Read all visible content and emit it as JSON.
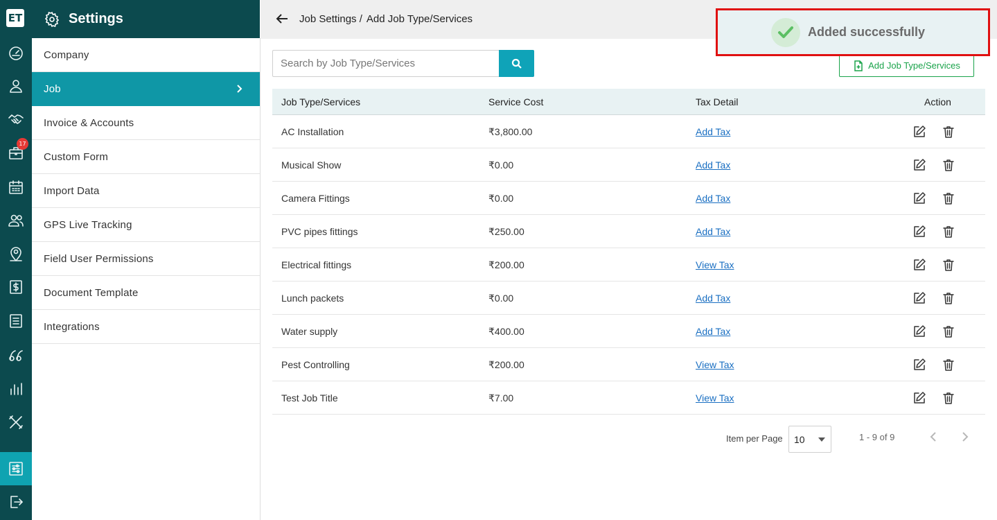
{
  "rail": {
    "logo_text": "ET",
    "badge_count": "17",
    "icons": [
      "dashboard-icon",
      "user-icon",
      "handshake-icon",
      "briefcase-icon",
      "calendar-icon",
      "users-icon",
      "location-user-icon",
      "dollar-icon",
      "list-icon",
      "leads-icon",
      "reports-icon",
      "tools-icon",
      "settings-sliders-icon",
      "logout-icon"
    ]
  },
  "settings": {
    "title": "Settings",
    "menu": [
      {
        "label": "Company"
      },
      {
        "label": "Job"
      },
      {
        "label": "Invoice & Accounts"
      },
      {
        "label": "Custom Form"
      },
      {
        "label": "Import Data"
      },
      {
        "label": "GPS Live Tracking"
      },
      {
        "label": "Field User Permissions"
      },
      {
        "label": "Document Template"
      },
      {
        "label": "Integrations"
      }
    ],
    "active_item": "Job"
  },
  "breadcrumb": {
    "parent": "Job Settings /",
    "current": "Add Job Type/Services"
  },
  "search": {
    "placeholder": "Search by Job Type/Services",
    "value": ""
  },
  "add_button": {
    "label": "Add Job Type/Services"
  },
  "table": {
    "headers": {
      "service": "Job Type/Services",
      "cost": "Service Cost",
      "tax": "Tax Detail",
      "action": "Action"
    },
    "rows": [
      {
        "service": "AC Installation",
        "cost": "₹3,800.00",
        "tax": "Add Tax"
      },
      {
        "service": "Musical Show",
        "cost": "₹0.00",
        "tax": "Add Tax"
      },
      {
        "service": "Camera Fittings",
        "cost": "₹0.00",
        "tax": "Add Tax"
      },
      {
        "service": "PVC pipes fittings",
        "cost": "₹250.00",
        "tax": "Add Tax"
      },
      {
        "service": "Electrical fittings",
        "cost": "₹200.00",
        "tax": "View Tax"
      },
      {
        "service": "Lunch packets",
        "cost": "₹0.00",
        "tax": "Add Tax"
      },
      {
        "service": "Water supply",
        "cost": "₹400.00",
        "tax": "Add Tax"
      },
      {
        "service": "Pest Controlling",
        "cost": "₹200.00",
        "tax": "View Tax"
      },
      {
        "service": "Test Job Title",
        "cost": "₹7.00",
        "tax": "View Tax"
      }
    ]
  },
  "pagination": {
    "label": "Item per Page",
    "per_page": "10",
    "range": "1 - 9 of 9"
  },
  "toast": {
    "message": "Added successfully"
  },
  "colors": {
    "rail_bg": "#0c4a4e",
    "active_teal": "#0f97a6",
    "add_green": "#1aa34a",
    "link_blue": "#1a6fc2",
    "toast_border": "#e01010"
  }
}
